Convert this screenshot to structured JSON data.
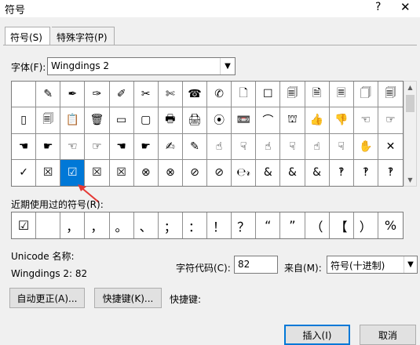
{
  "window": {
    "title": "符号",
    "help": "?",
    "close": "✕"
  },
  "tabs": [
    {
      "label": "符号(S)"
    },
    {
      "label": "特殊字符(P)"
    }
  ],
  "font": {
    "label": "字体(F):",
    "value": "Wingdings 2"
  },
  "symbols": [
    "",
    "✎",
    "✒",
    "✑",
    "✐",
    "✂",
    "✄",
    "☎",
    "✆",
    "🗋",
    "☐",
    "🗐",
    "🗎",
    "🗏",
    "🗍",
    "🗐",
    "▯",
    "🗐",
    "📋",
    "🗑",
    "▭",
    "▢",
    "🖶",
    "🖨",
    "⦿",
    "📼",
    "⌒",
    "⛫",
    "👍",
    "👎",
    "☜",
    "☞",
    "☚",
    "☛",
    "☜",
    "☞",
    "☚",
    "☛",
    "✍",
    "✎",
    "☝",
    "☟",
    "☝",
    "☟",
    "☝",
    "☟",
    "✋",
    "✕",
    "✓",
    "☒",
    "☑",
    "☒",
    "☒",
    "⊗",
    "⊗",
    "⊘",
    "⊘",
    "℮𝓇",
    "&",
    "&",
    "&",
    "‽",
    "‽",
    "‽"
  ],
  "selected_index": 50,
  "selected_color": "#0078d7",
  "recent": {
    "label": "近期使用过的符号(R):",
    "items": [
      "☑",
      "",
      "，",
      "，",
      "。",
      "、",
      "；",
      "：",
      "！",
      "？",
      "“",
      "”",
      "（",
      "【",
      "）",
      "%"
    ]
  },
  "unicode": {
    "label": "Unicode 名称:",
    "value": "Wingdings 2: 82"
  },
  "charcode": {
    "label": "字符代码(C):",
    "value": "82"
  },
  "from": {
    "label": "来自(M):",
    "value": "符号(十进制)"
  },
  "buttons": {
    "autocorrect": "自动更正(A)...",
    "shortcut": "快捷键(K)...",
    "shortcut_label": "快捷键:",
    "insert": "插入(I)",
    "cancel": "取消"
  },
  "annotation_color": "#e53935"
}
